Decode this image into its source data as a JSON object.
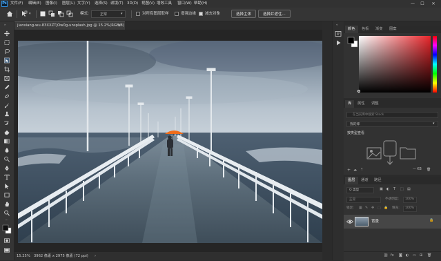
{
  "app": {
    "logo": "Ps"
  },
  "menu": [
    "文件(F)",
    "编辑(E)",
    "图像(I)",
    "图层(L)",
    "文字(Y)",
    "选择(S)",
    "滤镜(T)",
    "3D(D)",
    "视图(V)",
    "增效工具",
    "窗口(W)",
    "帮助(H)"
  ],
  "window_controls": [
    "—",
    "☐",
    "✕"
  ],
  "options": {
    "mode_label": "模式:",
    "mode_value": "正常",
    "check1": "对所有图层取样",
    "check2": "增强边缘",
    "check3": "减去对象",
    "btn1": "选择主体",
    "btn2": "选择并遮住..."
  },
  "document": {
    "tab_title": "jianxiang-wu-83XXZTjOw0g-unsplash.jpg @ 15.2%(RGB/8)",
    "close_icon": "×",
    "zoom": "15.25%",
    "dimensions": "3962 像素 x 2975 像素 (72 ppi)",
    "status_arrow": "›"
  },
  "color_panel": {
    "tabs": [
      "颜色",
      "色板",
      "渐变",
      "图案"
    ],
    "accent": "#e8262b"
  },
  "libraries_panel": {
    "tabs": [
      "库",
      "属性",
      "调整"
    ],
    "search_placeholder": "在当前库中搜索 Stock",
    "library_name": "我的库",
    "view_label": "按类型查看",
    "size_label": "— KB"
  },
  "layers_panel": {
    "tabs": [
      "图层",
      "通道",
      "路径"
    ],
    "filter_label": "Q 类型",
    "blend_mode": "正常",
    "opacity_label": "不透明度:",
    "opacity_value": "100%",
    "lock_label": "锁定:",
    "fill_label": "填充:",
    "fill_value": "100%",
    "layer_name": "背景"
  }
}
